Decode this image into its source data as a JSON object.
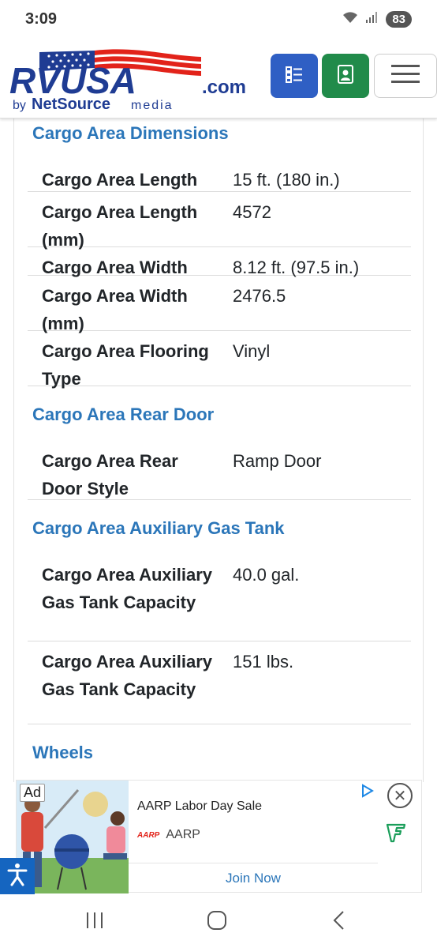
{
  "status": {
    "time": "3:09",
    "battery": "83"
  },
  "header": {
    "logo_main": "RVUSA",
    "logo_suffix": ".com",
    "logo_by": "by",
    "logo_netsource": "NetSource",
    "logo_media": "media",
    "icons": [
      "checklist-icon",
      "contact-card-icon",
      "hamburger-menu-icon"
    ]
  },
  "sections": [
    {
      "title": "Cargo Area Dimensions",
      "rows": [
        {
          "label": "Cargo Area Length",
          "value": "15 ft. (180 in.)"
        },
        {
          "label": "Cargo Area Length (mm)",
          "value": "4572"
        },
        {
          "label": "Cargo Area Width",
          "value": "8.12 ft. (97.5 in.)"
        },
        {
          "label": "Cargo Area Width (mm)",
          "value": "2476.5"
        },
        {
          "label": "Cargo Area Flooring Type",
          "value": "Vinyl"
        }
      ]
    },
    {
      "title": "Cargo Area Rear Door",
      "rows": [
        {
          "label": "Cargo Area Rear Door Style",
          "value": "Ramp Door"
        }
      ]
    },
    {
      "title": "Cargo Area Auxiliary Gas Tank",
      "rows": [
        {
          "label": "Cargo Area Auxiliary Gas Tank Capacity",
          "value": "40.0 gal."
        },
        {
          "label": "Cargo Area Auxiliary Gas Tank Capacity",
          "value": "151 lbs."
        }
      ]
    },
    {
      "title": "Wheels",
      "rows": []
    }
  ],
  "ad": {
    "label": "Ad",
    "title": "AARP Labor Day Sale",
    "brand_logo": "AARP",
    "brand": "AARP",
    "cta": "Join Now"
  },
  "colors": {
    "accent": "#2b76b9",
    "brand_red": "#e2231a",
    "brand_blue": "#1f3c93",
    "btn_blue": "#2f5fc4",
    "btn_green": "#218b4a"
  }
}
